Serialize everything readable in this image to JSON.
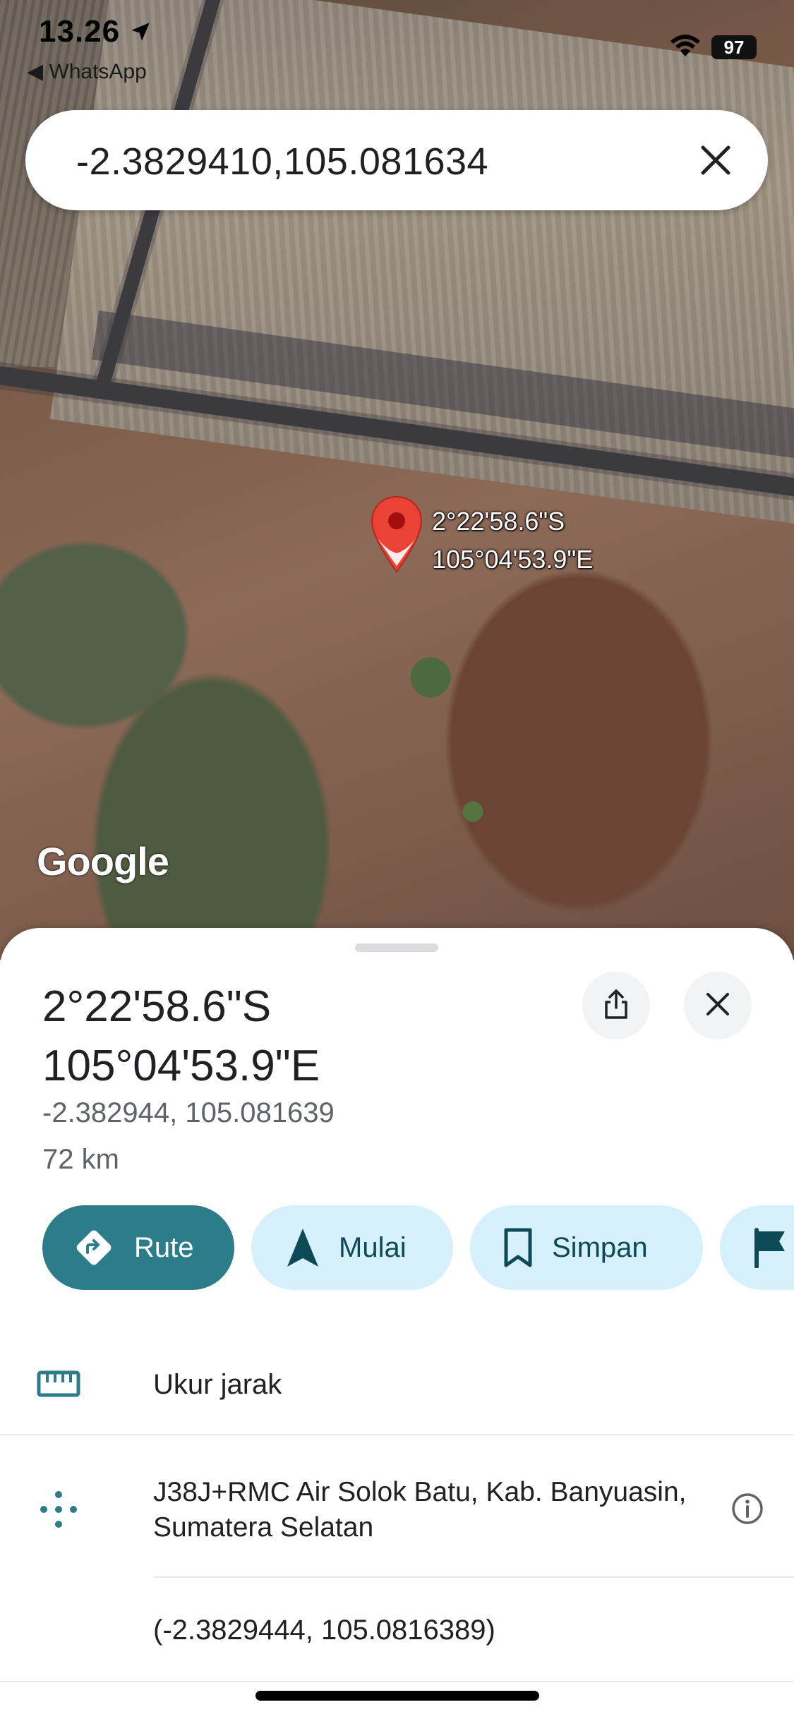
{
  "status_bar": {
    "time": "13.26",
    "back_app": "◀ WhatsApp",
    "battery": "97"
  },
  "search": {
    "query": "-2.3829410,105.081634"
  },
  "map": {
    "pin_label_lat": "2°22'58.6\"S",
    "pin_label_lng": "105°04'53.9\"E",
    "attribution": "Google"
  },
  "place": {
    "title_lat": "2°22'58.6\"S",
    "title_lng": "105°04'53.9\"E",
    "decimal": "-2.382944, 105.081639",
    "distance": "72 km"
  },
  "actions": [
    {
      "label": "Rute",
      "icon": "directions-icon"
    },
    {
      "label": "Mulai",
      "icon": "navigation-icon"
    },
    {
      "label": "Simpan",
      "icon": "bookmark-icon"
    },
    {
      "label": "",
      "icon": "flag-icon"
    }
  ],
  "rows": {
    "measure": "Ukur jarak",
    "plus_code": "J38J+RMC Air Solok Batu, Kab. Banyuasin, Sumatera Selatan",
    "coordinates": "(-2.3829444, 105.0816389)"
  },
  "colors": {
    "accent": "#2d7c8a",
    "chip_bg": "#d6f1fb",
    "pin": "#ea4335"
  }
}
